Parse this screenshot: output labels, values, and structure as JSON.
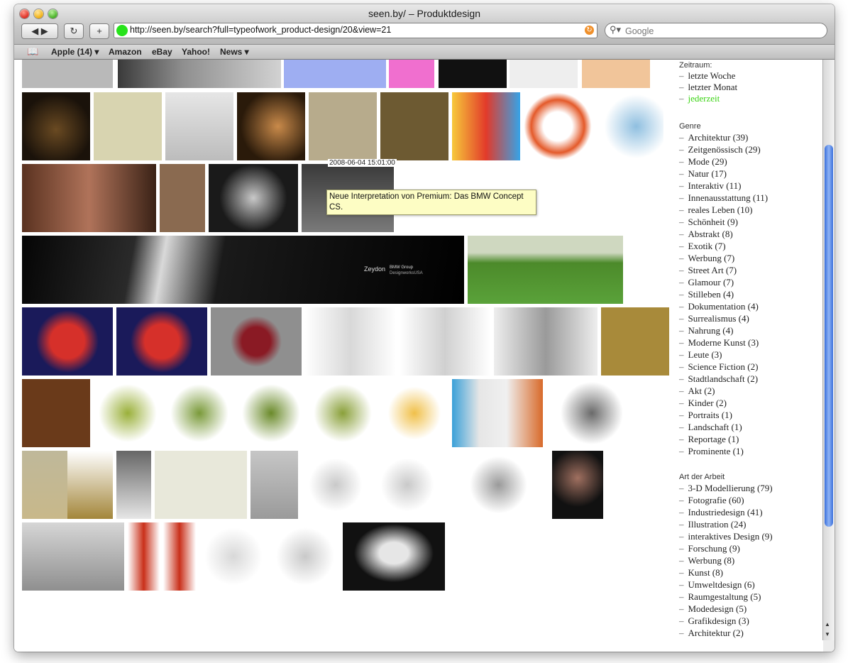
{
  "window": {
    "title": "seen.by/ – Produktdesign"
  },
  "toolbar": {
    "back_label": "◀ ▶",
    "reload_label": "↻",
    "add_label": "+",
    "url": "http://seen.by/search?full=typeofwork_product-design/20&view=21",
    "search_placeholder": "Google"
  },
  "bookmarks": [
    "Apple (14) ▾",
    "Amazon",
    "eBay",
    "Yahoo!",
    "News ▾"
  ],
  "tooltip": {
    "timestamp": "2008-06-04 15:01:00",
    "text": "Neue Interpretation von Premium: Das BMW Concept CS."
  },
  "banner_text": {
    "brand": "Zeydon",
    "group": "BMW Group",
    "sub": "DesignworksUSA"
  },
  "sidebar": {
    "zeitraum_label": "Zeitraum:",
    "zeitraum": [
      {
        "label": "letzte Woche",
        "active": false
      },
      {
        "label": "letzter Monat",
        "active": false
      },
      {
        "label": "jederzeit",
        "active": true
      }
    ],
    "genre_label": "Genre",
    "genre": [
      "Architektur (39)",
      "Zeitgenössisch (29)",
      "Mode (29)",
      "Natur (17)",
      "Interaktiv (11)",
      "Innenausstattung (11)",
      "reales Leben (10)",
      "Schönheit (9)",
      "Abstrakt (8)",
      "Exotik (7)",
      "Werbung (7)",
      "Street Art (7)",
      "Glamour (7)",
      "Stilleben (4)",
      "Dokumentation (4)",
      "Surrealismus (4)",
      "Nahrung (4)",
      "Moderne Kunst (3)",
      "Leute (3)",
      "Science Fiction (2)",
      "Stadtlandschaft (2)",
      "Akt (2)",
      "Kinder (2)",
      "Portraits (1)",
      "Landschaft (1)",
      "Reportage (1)",
      "Prominente (1)"
    ],
    "art_label": "Art der Arbeit",
    "art": [
      "3-D Modellierung (79)",
      "Fotografie (60)",
      "Industriedesign (41)",
      "Illustration (24)",
      "interaktives Design (9)",
      "Forschung (9)",
      "Werbung (8)",
      "Kunst (8)",
      "Umweltdesign (6)",
      "Raumgestaltung (5)",
      "Modedesign (5)",
      "Grafikdesign (3)",
      "Architektur (2)"
    ]
  },
  "colors": {
    "active_link": "#39d312",
    "tooltip_bg": "#fdfdc4",
    "scroll_thumb": "#3a6fdc"
  }
}
